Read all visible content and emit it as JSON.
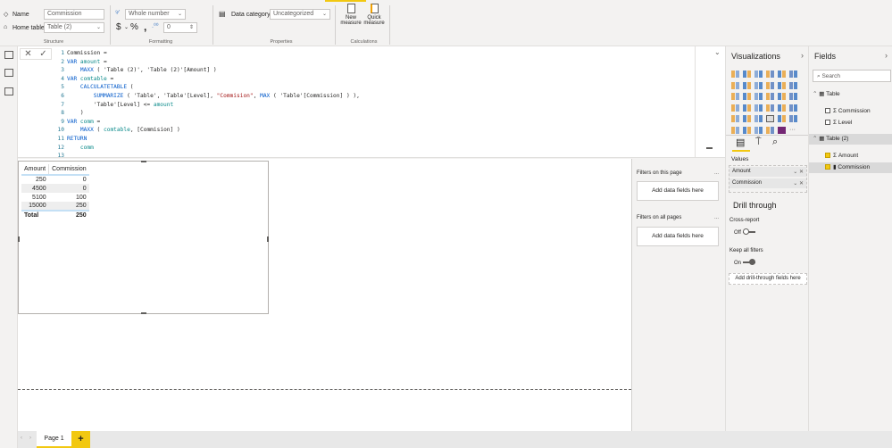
{
  "ribbon": {
    "name_label": "Name",
    "name_value": "Commission",
    "home_table_label": "Home table",
    "home_table_value": "Table (2)",
    "structure_group": "Structure",
    "format_value": "Whole number",
    "currency": "$",
    "percent": "%",
    "comma": ",",
    "decimals": "0",
    "formatting_group": "Formatting",
    "data_category_label": "Data category",
    "data_category_value": "Uncategorized",
    "properties_group": "Properties",
    "new_measure_1": "New",
    "new_measure_2": "measure",
    "quick_measure_1": "Quick",
    "quick_measure_2": "measure",
    "calculations_group": "Calculations"
  },
  "formula": {
    "cancel": "✕",
    "commit": "✓",
    "lines": [
      [
        [
          "Commission =",
          "p"
        ]
      ],
      [
        [
          "VAR ",
          "k"
        ],
        [
          "amount",
          "v"
        ],
        [
          " =",
          "p"
        ]
      ],
      [
        [
          "    MAXX",
          "f"
        ],
        [
          " ( 'Table (2)', 'Table (2)'[Amount] )",
          "p"
        ]
      ],
      [
        [
          "VAR ",
          "k"
        ],
        [
          "comtable",
          "v"
        ],
        [
          " =",
          "p"
        ]
      ],
      [
        [
          "    CALCULATETABLE",
          "f"
        ],
        [
          " (",
          "p"
        ]
      ],
      [
        [
          "        SUMMARIZE",
          "f"
        ],
        [
          " ( 'Table', 'Table'[Level], ",
          "p"
        ],
        [
          "\"Commision\"",
          "s"
        ],
        [
          ", ",
          "p"
        ],
        [
          "MAX",
          "f"
        ],
        [
          " ( 'Table'[Commission] ) ),",
          "p"
        ]
      ],
      [
        [
          "        'Table'[Level] <= ",
          "p"
        ],
        [
          "amount",
          "v"
        ]
      ],
      [
        [
          "    )",
          "p"
        ]
      ],
      [
        [
          "VAR ",
          "k"
        ],
        [
          "comm",
          "v"
        ],
        [
          " =",
          "p"
        ]
      ],
      [
        [
          "    MAXX",
          "f"
        ],
        [
          " ( ",
          "p"
        ],
        [
          "comtable",
          "v"
        ],
        [
          ", [Commision] )",
          "p"
        ]
      ],
      [
        [
          "RETURN",
          "k"
        ]
      ],
      [
        [
          "    comm",
          "v"
        ]
      ],
      [
        [
          "",
          "p"
        ]
      ]
    ]
  },
  "table_visual": {
    "headers": [
      "Amount",
      "Commission"
    ],
    "rows": [
      [
        "250",
        "0"
      ],
      [
        "4500",
        "0"
      ],
      [
        "5100",
        "100"
      ],
      [
        "15000",
        "250"
      ]
    ],
    "total": [
      "Total",
      "250"
    ]
  },
  "filters": {
    "this_page": "Filters on this page",
    "all_pages": "Filters on all pages",
    "add": "Add data fields here",
    "more": "..."
  },
  "visualizations": {
    "title": "Visualizations",
    "values_label": "Values",
    "wells": [
      "Amount",
      "Commission"
    ],
    "drill_through": "Drill through",
    "cross_report": "Cross-report",
    "cross_report_state": "Off",
    "keep_all_filters": "Keep all filters",
    "keep_all_filters_state": "On",
    "add_drill": "Add drill-through fields here",
    "icon_colors": [
      "#e8a33d",
      "#3c78c3",
      "#7b9fd4",
      "#e8a33d",
      "#3c78c3",
      "#5a80c0"
    ],
    "selected_icon_color": "#742774"
  },
  "fields": {
    "title": "Fields",
    "search_placeholder": "Search",
    "tables": [
      {
        "name": "Table",
        "expanded": true,
        "items": [
          {
            "label": "Commission",
            "checked": false,
            "type": "sigma"
          },
          {
            "label": "Level",
            "checked": false,
            "type": "sigma"
          }
        ]
      },
      {
        "name": "Table (2)",
        "expanded": true,
        "items": [
          {
            "label": "Amount",
            "checked": true,
            "type": "sigma"
          },
          {
            "label": "Commission",
            "checked": true,
            "type": "measure"
          }
        ]
      }
    ]
  },
  "pages": {
    "tabs": [
      "Page 1"
    ],
    "add": "+"
  },
  "colors": {
    "accent": "#f2c811",
    "selected_row": "#d9d9d9"
  }
}
